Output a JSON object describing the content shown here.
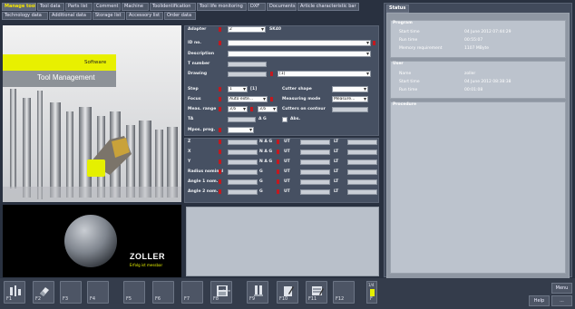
{
  "tabs_row1": [
    {
      "label": "Manage tool",
      "active": true
    },
    {
      "label": "Tool data",
      "active": false
    },
    {
      "label": "Parts list",
      "active": false
    },
    {
      "label": "Comment",
      "active": false
    },
    {
      "label": "Machine",
      "active": false
    },
    {
      "label": "Toolidentification",
      "active": false
    },
    {
      "label": "Tool life monitoring",
      "active": false
    },
    {
      "label": "DXF",
      "active": false
    },
    {
      "label": "Documents",
      "active": false
    },
    {
      "label": "Article characteristic bar",
      "active": false
    }
  ],
  "tabs_row2": [
    {
      "label": "Technology data"
    },
    {
      "label": "Additional data"
    },
    {
      "label": "Storage list"
    },
    {
      "label": "Accessory list"
    },
    {
      "label": "Order data"
    }
  ],
  "banner": {
    "software": "Software",
    "title": "Tool Management"
  },
  "logo": {
    "name": "ZOLLER",
    "slogan": "Erfolg ist messbar"
  },
  "form": {
    "adapter_label": "Adapter",
    "adapter_value": "2",
    "adapter_text": "SK40",
    "id_label": "ID no.",
    "description_label": "Description",
    "tnumber_label": "T number",
    "drawing_label": "Drawing",
    "drawing_value": "[1]",
    "step_label": "Step",
    "step_value": "1",
    "step_of": "[1]",
    "cutter_shape_label": "Cutter shape",
    "focus_label": "Focus",
    "focus_value": "Auto exte...",
    "measuring_mode_label": "Measuring mode",
    "measuring_mode_value": "Measure...",
    "meas_range_label": "Meas. range",
    "meas_range_v1": "3,6",
    "meas_range_v2": "3,6",
    "cutters_on_contour_label": "Cutters on contour",
    "ta_label": "TA",
    "ag_label": "A G",
    "abs_label": "Abs.",
    "mpos_label": "Mpos. prog."
  },
  "measure_rows": [
    {
      "label": "Z",
      "nag": "N A G",
      "ut": "UT",
      "lt": "LT"
    },
    {
      "label": "X",
      "nag": "N A G",
      "ut": "UT",
      "lt": "LT"
    },
    {
      "label": "Y",
      "nag": "N A G",
      "ut": "UT",
      "lt": "LT"
    },
    {
      "label": "Radius nominal",
      "nag": "G",
      "ut": "UT",
      "lt": "LT"
    },
    {
      "label": "Angle 1 nom.",
      "nag": "G",
      "ut": "UT",
      "lt": "LT"
    },
    {
      "label": "Angle 2 nom.",
      "nag": "G",
      "ut": "UT",
      "lt": "LT"
    }
  ],
  "status": {
    "tab_label": "Status",
    "program_title": "Program",
    "program_rows": [
      {
        "label": "Start time",
        "value": "04 June 2012 07:44:29"
      },
      {
        "label": "Run time",
        "value": "00:55:07"
      },
      {
        "label": "Memory requirement",
        "value": "1107 MByte"
      }
    ],
    "user_title": "User",
    "user_rows": [
      {
        "label": "Name",
        "value": "zoller"
      },
      {
        "label": "Start time",
        "value": "04 June 2012 08:38:38"
      },
      {
        "label": "Run time",
        "value": "00:01:08"
      }
    ],
    "procedure_title": "Procedure"
  },
  "fkeys": [
    {
      "key": "F1",
      "icon": "measure-icon",
      "has_icon": true
    },
    {
      "key": "F2",
      "icon": "eraser-icon",
      "has_icon": true
    },
    {
      "key": "F3",
      "icon": "",
      "has_icon": false
    },
    {
      "key": "F4",
      "icon": "",
      "has_icon": false
    },
    {
      "key": "F5",
      "icon": "",
      "has_icon": false
    },
    {
      "key": "F6",
      "icon": "",
      "has_icon": false
    },
    {
      "key": "F7",
      "icon": "",
      "has_icon": false
    },
    {
      "key": "F8",
      "icon": "save-icon",
      "has_icon": true,
      "extra": "Save"
    },
    {
      "key": "F9",
      "icon": "tool-holder-icon",
      "has_icon": true
    },
    {
      "key": "F10",
      "icon": "edit-icon",
      "has_icon": true
    },
    {
      "key": "F11",
      "icon": "list-edit-icon",
      "has_icon": true
    },
    {
      "key": "F12",
      "icon": "",
      "has_icon": false
    }
  ],
  "page_indicator": "1/4",
  "f_label": "F",
  "menu_label": "Menu",
  "help_label": "Help",
  "more_label": "..."
}
